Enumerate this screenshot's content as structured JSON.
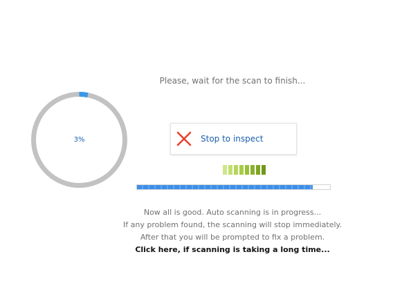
{
  "scan": {
    "wait_message": "Please, wait for the scan to finish...",
    "percent_label": "3%",
    "percent_value": 3,
    "ring_track_color": "#c2c2c2",
    "ring_progress_color": "#3a97e8",
    "stop_label": "Stop to inspect",
    "stop_icon": "close-x-icon",
    "stop_icon_color": "#e8412c",
    "activity_segments": [
      "#cfe68c",
      "#c2df72",
      "#b5d65c",
      "#a6cc48",
      "#98c037",
      "#8ab22b",
      "#7ea421",
      "#72961a"
    ],
    "progress_value": 0.91,
    "progress_color": "#3e8ee6"
  },
  "info": {
    "line1": "Now all is good. Auto scanning is in progress...",
    "line2": "If any problem found, the scanning will stop immediately.",
    "line3": "After that you will be prompted to fix a problem.",
    "long_time_link": "Click here, if scanning is taking a long time..."
  }
}
